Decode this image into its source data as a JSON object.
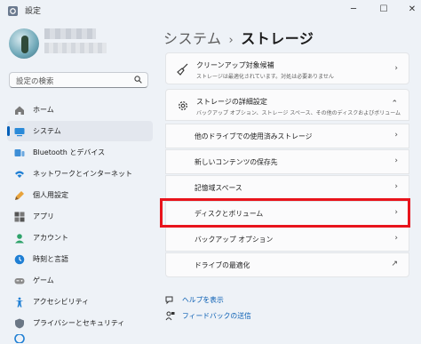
{
  "window": {
    "title": "設定"
  },
  "search": {
    "placeholder": "設定の検索"
  },
  "nav": [
    {
      "label": "ホーム",
      "icon": "home-icon"
    },
    {
      "label": "システム",
      "icon": "system-icon",
      "active": true
    },
    {
      "label": "Bluetooth とデバイス",
      "icon": "bluetooth-icon"
    },
    {
      "label": "ネットワークとインターネット",
      "icon": "network-icon"
    },
    {
      "label": "個人用設定",
      "icon": "brush-icon"
    },
    {
      "label": "アプリ",
      "icon": "apps-icon"
    },
    {
      "label": "アカウント",
      "icon": "account-icon"
    },
    {
      "label": "時刻と言語",
      "icon": "time-language-icon"
    },
    {
      "label": "ゲーム",
      "icon": "game-icon"
    },
    {
      "label": "アクセシビリティ",
      "icon": "accessibility-icon"
    },
    {
      "label": "プライバシーとセキュリティ",
      "icon": "shield-icon"
    }
  ],
  "breadcrumb": {
    "parent": "システム",
    "separator": "›",
    "current": "ストレージ"
  },
  "cleanup": {
    "title": "クリーンアップ対象候補",
    "desc": "ストレージは最適化されています。対処は必要ありません"
  },
  "advanced": {
    "title": "ストレージの詳細設定",
    "desc": "バックアップ オプション、ストレージ スペース、その他のディスクおよびボリューム"
  },
  "advanced_items": [
    {
      "label": "他のドライブでの使用済みストレージ",
      "arrow": "›"
    },
    {
      "label": "新しいコンテンツの保存先",
      "arrow": "›"
    },
    {
      "label": "記憶域スペース",
      "arrow": "›"
    },
    {
      "label": "ディスクとボリューム",
      "arrow": "›"
    },
    {
      "label": "バックアップ オプション",
      "arrow": "›"
    },
    {
      "label": "ドライブの最適化",
      "arrow": "↗"
    }
  ],
  "help": {
    "get_help": "ヘルプを表示",
    "feedback": "フィードバックの送信"
  },
  "colors": {
    "accent": "#005fb8",
    "highlight": "#e8141c",
    "link": "#0a5fb4"
  }
}
